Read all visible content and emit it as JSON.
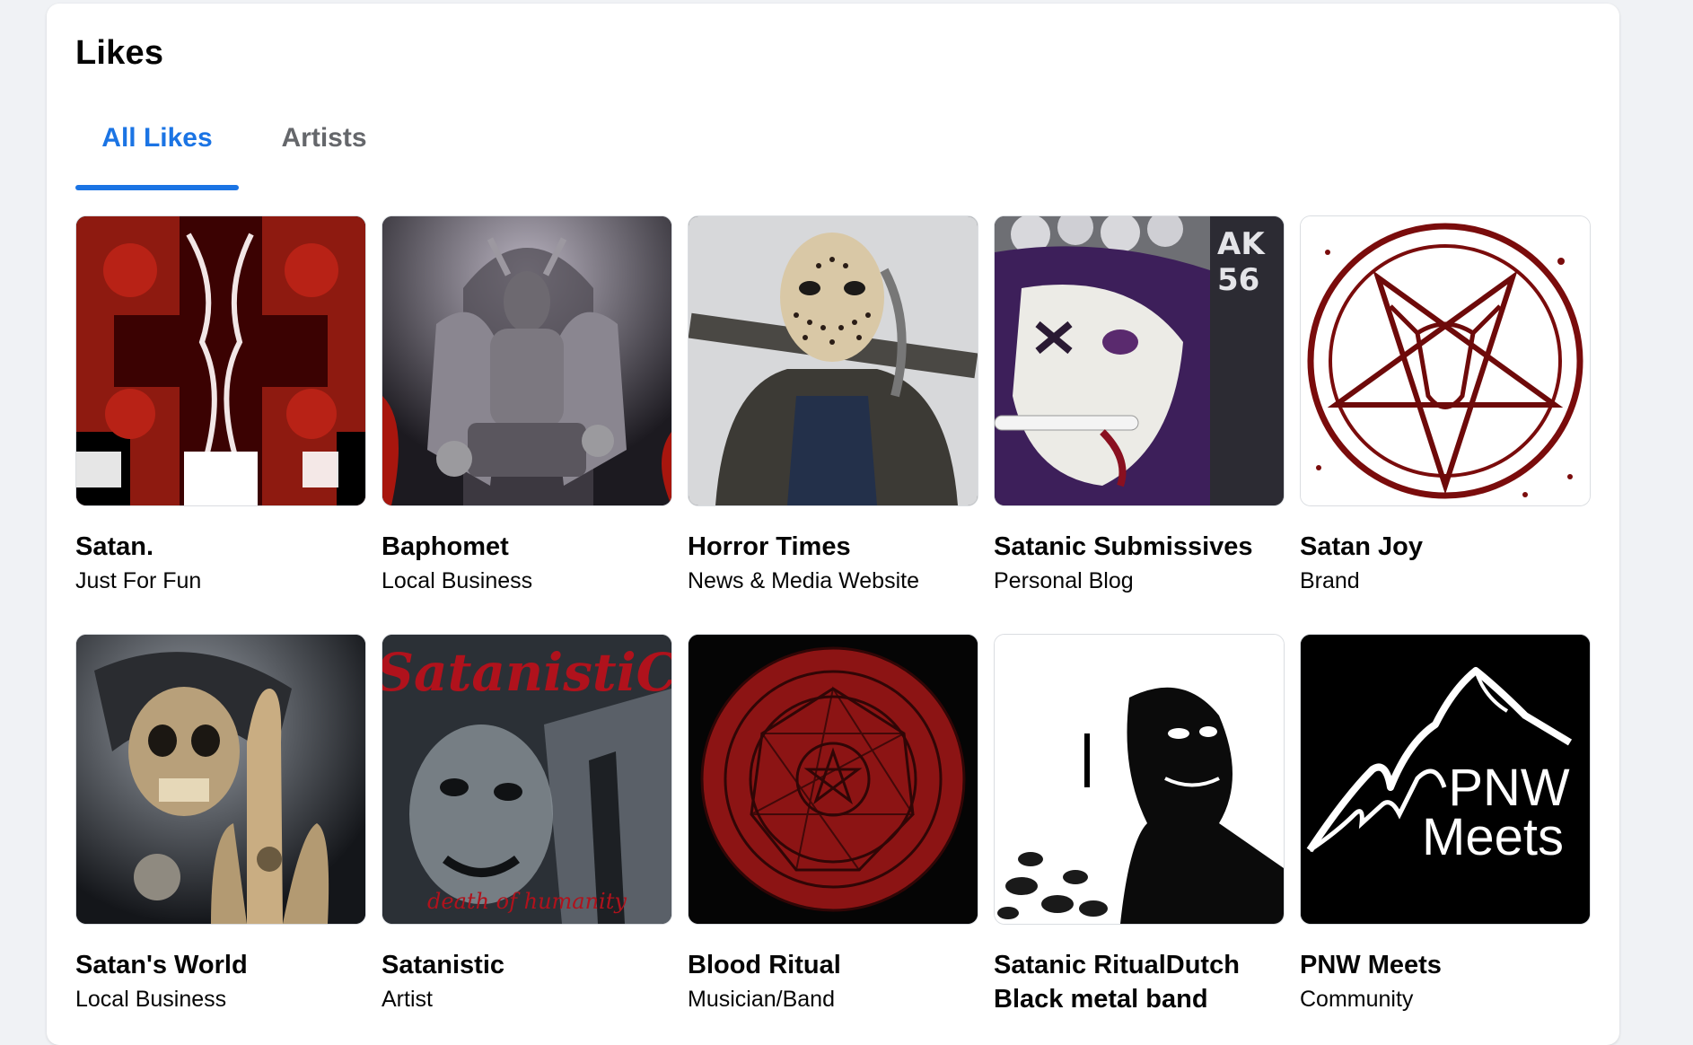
{
  "header": {
    "title": "Likes"
  },
  "tabs": [
    {
      "label": "All Likes",
      "active": true
    },
    {
      "label": "Artists",
      "active": false
    }
  ],
  "colors": {
    "accent": "#1b74e4",
    "muted": "#65676b",
    "background": "#f0f2f5"
  },
  "likes": [
    {
      "name": "Satan.",
      "category": "Just For Fun",
      "image": "red-inverted-cross-art"
    },
    {
      "name": "Baphomet",
      "category": "Local Business",
      "image": "baphomet-statue"
    },
    {
      "name": "Horror Times",
      "category": "News & Media Website",
      "image": "hockey-mask-figure"
    },
    {
      "name": "Satanic Submissives",
      "category": "Personal Blog",
      "image": "anime-girl-art"
    },
    {
      "name": "Satan Joy",
      "category": "Brand",
      "image": "pentagram-goat-drawing"
    },
    {
      "name": "Satan's World",
      "category": "Local Business",
      "image": "skeleton-reaper"
    },
    {
      "name": "Satanistic",
      "category": "Artist",
      "image": "satanistic-album-cover",
      "logo_text": "SatanistiC",
      "cover_caption": "death of humanity"
    },
    {
      "name": "Blood Ritual",
      "category": "Musician/Band",
      "image": "red-sigil-circle"
    },
    {
      "name": "Satanic RitualDutch Black metal band",
      "category": "",
      "image": "bw-photo-man"
    },
    {
      "name": "PNW Meets",
      "category": "Community",
      "image": "pnw-mountain-logo",
      "logo_text_line1": "PNW",
      "logo_text_line2": "Meets"
    }
  ]
}
